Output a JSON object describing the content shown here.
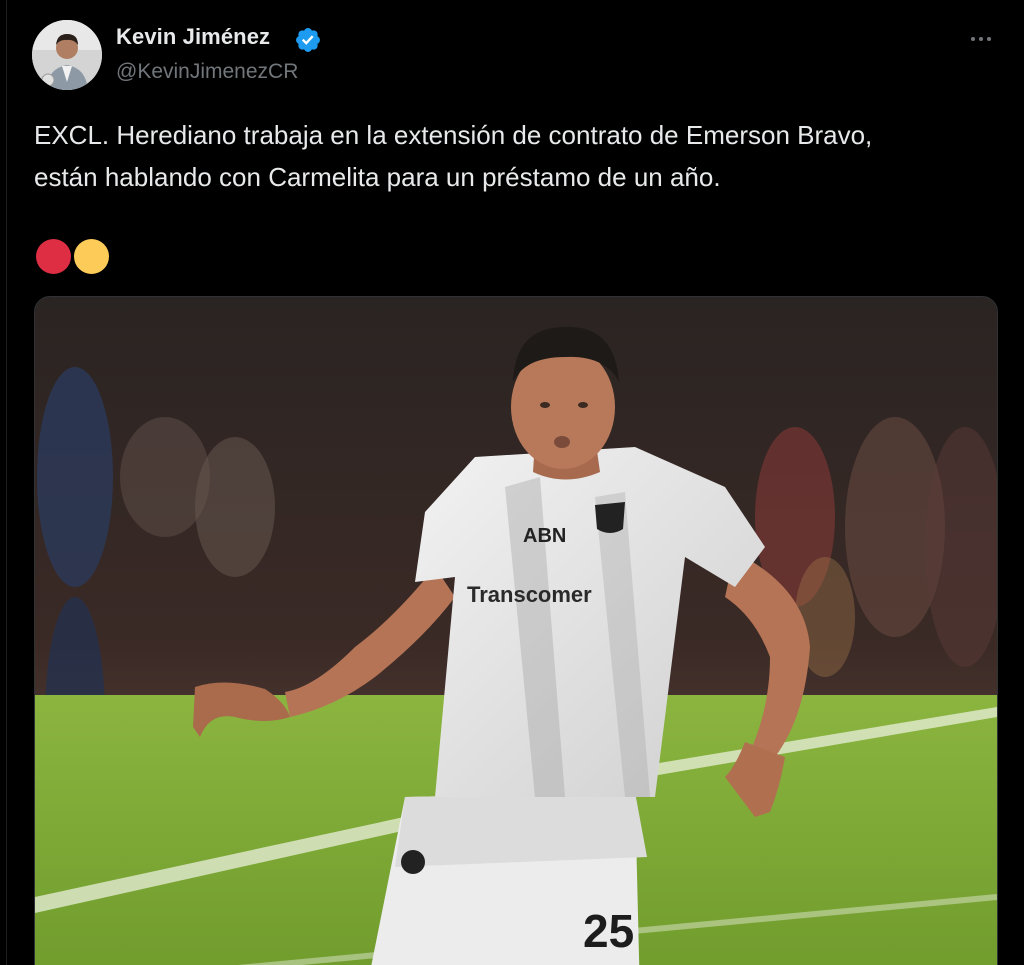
{
  "author": {
    "display_name": "Kevin Jiménez",
    "handle": "@KevinJimenezCR",
    "verified": true,
    "avatar_icon": "profile-photo"
  },
  "tweet": {
    "text_lines": [
      "EXCL. Herediano trabaja en la extensión de contrato de Emerson Bravo,",
      "están hablando con Carmelita para un préstamo de un año."
    ],
    "emoji": [
      "red-circle",
      "yellow-circle"
    ]
  },
  "media": {
    "description_icon": "soccer-player-photo",
    "jersey_sponsor": "Transcomer",
    "jersey_top": "ABN",
    "shirt_number": "25"
  },
  "colors": {
    "background": "#000000",
    "text_primary": "#e7e9ea",
    "text_secondary": "#71767b",
    "verified_blue": "#1d9bf0",
    "emoji_red": "#dd2e44",
    "emoji_yellow": "#fdcb58"
  },
  "icons": {
    "verified": "verified-badge-icon",
    "more": "more-options-icon"
  }
}
